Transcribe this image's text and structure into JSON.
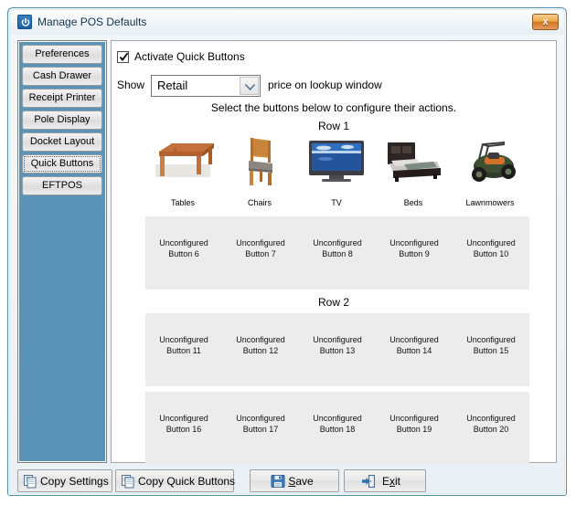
{
  "window": {
    "title": "Manage POS Defaults",
    "app_icon": "power-icon",
    "close_label": "x",
    "close_icon": "close-icon",
    "accent_color": "#5b92b8",
    "close_button_color": "#d2761f"
  },
  "sidebar": {
    "items": [
      {
        "label": "Preferences",
        "selected": false
      },
      {
        "label": "Cash Drawer",
        "selected": false
      },
      {
        "label": "Receipt Printer",
        "selected": false
      },
      {
        "label": "Pole Display",
        "selected": false
      },
      {
        "label": "Docket Layout",
        "selected": false
      },
      {
        "label": "Quick Buttons",
        "selected": true
      },
      {
        "label": "EFTPOS",
        "selected": false
      }
    ]
  },
  "main": {
    "activate": {
      "label": "Activate Quick Buttons",
      "checked": true
    },
    "price_setting": {
      "prefix_label": "Show",
      "selected_value": "Retail",
      "options": [
        "Retail"
      ],
      "suffix_label": "price on lookup window",
      "dropdown_icon": "chevron-down-icon"
    },
    "instruction": "Select the buttons below to configure their actions.",
    "row1_label": "Row 1",
    "row2_label": "Row 2",
    "configured_buttons": [
      {
        "caption": "Tables",
        "image": "table-image"
      },
      {
        "caption": "Chairs",
        "image": "chair-image"
      },
      {
        "caption": "TV",
        "image": "tv-image"
      },
      {
        "caption": "Beds",
        "image": "bed-image"
      },
      {
        "caption": "Lawnmowers",
        "image": "lawnmower-image"
      }
    ],
    "unconfigured_panels": [
      {
        "buttons": [
          {
            "line1": "Unconfigured",
            "line2": "Button 6"
          },
          {
            "line1": "Unconfigured",
            "line2": "Button 7"
          },
          {
            "line1": "Unconfigured",
            "line2": "Button 8"
          },
          {
            "line1": "Unconfigured",
            "line2": "Button 9"
          },
          {
            "line1": "Unconfigured",
            "line2": "Button 10"
          }
        ]
      },
      {
        "buttons": [
          {
            "line1": "Unconfigured",
            "line2": "Button 11"
          },
          {
            "line1": "Unconfigured",
            "line2": "Button 12"
          },
          {
            "line1": "Unconfigured",
            "line2": "Button 13"
          },
          {
            "line1": "Unconfigured",
            "line2": "Button 14"
          },
          {
            "line1": "Unconfigured",
            "line2": "Button 15"
          }
        ]
      },
      {
        "buttons": [
          {
            "line1": "Unconfigured",
            "line2": "Button 16"
          },
          {
            "line1": "Unconfigured",
            "line2": "Button 17"
          },
          {
            "line1": "Unconfigured",
            "line2": "Button 18"
          },
          {
            "line1": "Unconfigured",
            "line2": "Button 19"
          },
          {
            "line1": "Unconfigured",
            "line2": "Button 20"
          }
        ]
      }
    ]
  },
  "bottom_bar": {
    "copy_settings": {
      "label": "Copy Settings",
      "icon": "copy-icon"
    },
    "copy_quick_buttons": {
      "label": "Copy Quick Buttons",
      "icon": "copy-icon"
    },
    "save": {
      "label_pre": "",
      "mnemonic": "S",
      "label_post": "ave",
      "icon": "floppy-disk-icon"
    },
    "exit": {
      "label_pre": "E",
      "mnemonic": "x",
      "label_post": "it",
      "icon": "exit-door-icon"
    }
  }
}
